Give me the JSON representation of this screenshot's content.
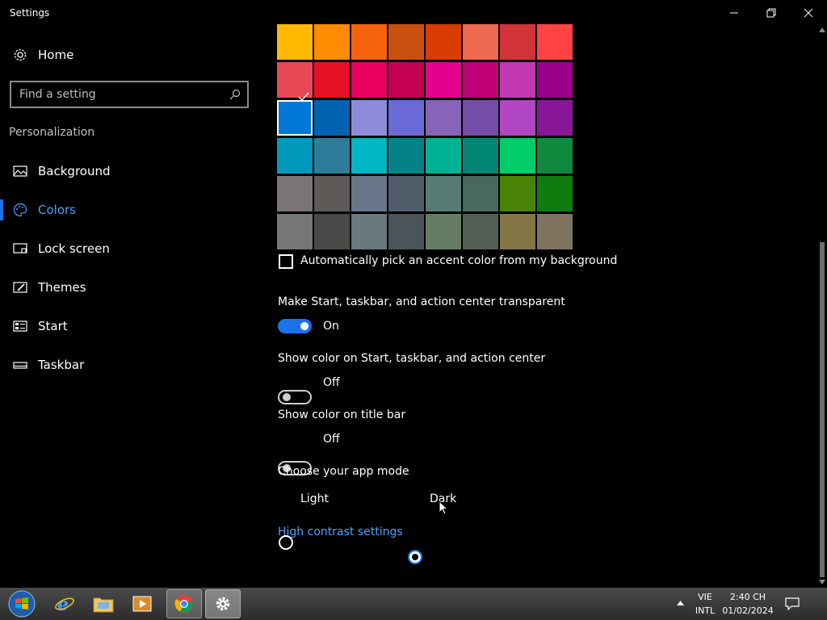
{
  "window": {
    "title": "Settings"
  },
  "sidebar": {
    "home_label": "Home",
    "search_placeholder": "Find a setting",
    "section_title": "Personalization",
    "items": [
      {
        "label": "Background",
        "icon": "image-icon"
      },
      {
        "label": "Colors",
        "icon": "palette-icon",
        "active": true
      },
      {
        "label": "Lock screen",
        "icon": "lock-screen-icon"
      },
      {
        "label": "Themes",
        "icon": "themes-icon"
      },
      {
        "label": "Start",
        "icon": "start-icon"
      },
      {
        "label": "Taskbar",
        "icon": "taskbar-icon"
      }
    ]
  },
  "accent_colors": {
    "selected": "#0078d7",
    "rows": [
      [
        "#ffb900",
        "#ff8c00",
        "#f7630c",
        "#ca5010",
        "#da3b01",
        "#ef6950",
        "#d13438",
        "#ff4343"
      ],
      [
        "#e74856",
        "#e81123",
        "#ea005e",
        "#c30052",
        "#e3008c",
        "#bf0077",
        "#c239b3",
        "#9a0089"
      ],
      [
        "#0078d7",
        "#0063b1",
        "#8e8cd8",
        "#6b69d6",
        "#8764b8",
        "#744da9",
        "#b146c2",
        "#881798"
      ],
      [
        "#0099bc",
        "#2d7d9a",
        "#00b7c3",
        "#038387",
        "#00b294",
        "#018574",
        "#00cc6a",
        "#10893e"
      ],
      [
        "#7a7574",
        "#5d5a58",
        "#68768a",
        "#515c6b",
        "#567c73",
        "#486860",
        "#498205",
        "#107c10"
      ],
      [
        "#767676",
        "#4c4a48",
        "#69797e",
        "#4a5459",
        "#647c64",
        "#525e54",
        "#847545",
        "#7e735f"
      ]
    ]
  },
  "auto_pick": {
    "label": "Automatically pick an accent color from my background",
    "checked": false
  },
  "transparency": {
    "label": "Make Start, taskbar, and action center transparent",
    "state": "On"
  },
  "show_color_start": {
    "label": "Show color on Start, taskbar, and action center",
    "state": "Off"
  },
  "show_color_titlebar": {
    "label": "Show color on title bar",
    "state": "Off"
  },
  "app_mode": {
    "label": "Choose your app mode",
    "options": [
      "Light",
      "Dark"
    ],
    "selected": "Dark"
  },
  "high_contrast_link": "High contrast settings",
  "taskbar": {
    "language_line1": "VIE",
    "language_line2": "INTL",
    "time": "2:40 CH",
    "date": "01/02/2024"
  }
}
